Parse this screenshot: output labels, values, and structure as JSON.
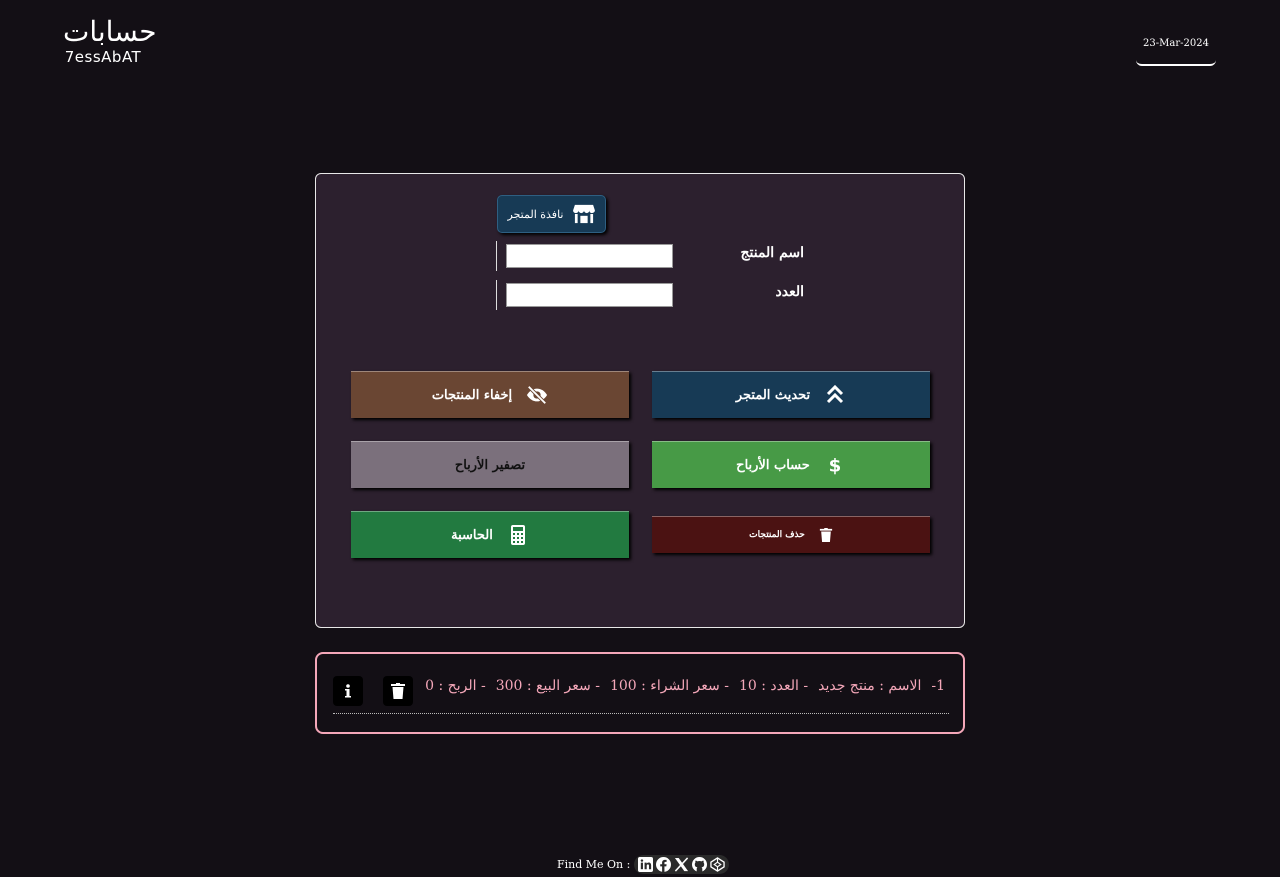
{
  "header": {
    "logo_arabic": "حسابات",
    "logo_latin": "7essAbAT",
    "date": "23-Mar-2024"
  },
  "form": {
    "store_window_label": "نافذة المتجر",
    "product_name_label": "اسم المنتج",
    "product_name_value": "",
    "quantity_label": "العدد",
    "quantity_value": ""
  },
  "actions": {
    "hide_products": "إخفاء المنتجات",
    "update_store": "تحديث المتجر",
    "reset_profits": "تصفير الأرباح",
    "calculate_profits": "حساب الأرباح",
    "calculator": "الحاسبة",
    "delete_products": "حذف المنتجات"
  },
  "products": [
    {
      "index": "1-",
      "name": "الاسم : منتج جديد",
      "quantity": "- العدد : 10",
      "buy_price": "- سعر الشراء : 100",
      "sell_price": "- سعر البيع : 300",
      "profit": "- الربح : 0"
    }
  ],
  "footer": {
    "find_me_label": "Find Me On :",
    "social_icons": [
      "linkedin-icon",
      "facebook-icon",
      "x-icon",
      "github-icon",
      "codepen-icon"
    ]
  },
  "colors": {
    "background": "#130f15",
    "panel": "#2c202e",
    "accent_pink": "#f4a7b9",
    "blue": "#173a55",
    "brown": "#6a4633",
    "grey": "#7b707c",
    "green": "#479a46",
    "dark_green": "#227a40",
    "dark_red": "#4b1212"
  }
}
